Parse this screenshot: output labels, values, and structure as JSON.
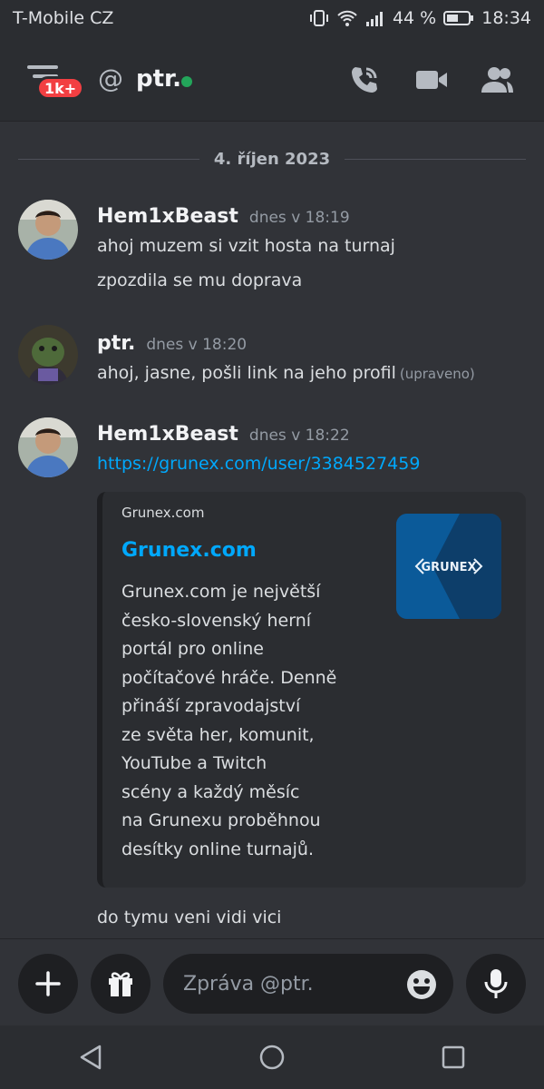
{
  "status_bar": {
    "carrier": "T-Mobile CZ",
    "battery_percent": "44 %",
    "time": "18:34"
  },
  "header": {
    "unread_badge": "1k+",
    "at_symbol": "@",
    "channel_name": "ptr.",
    "status": "online",
    "icons": [
      "menu-icon",
      "call-icon",
      "video-icon",
      "members-icon"
    ]
  },
  "date_divider": "4. říjen 2023",
  "messages": [
    {
      "author": "Hem1xBeast",
      "time": "dnes v 18:19",
      "lines": [
        "ahoj muzem si vzit hosta na turnaj",
        "zpozdila se mu doprava"
      ]
    },
    {
      "author": "ptr.",
      "time": "dnes v 18:20",
      "text": "ahoj, jasne, pošli link na jeho profil",
      "edited": "(upraveno)"
    },
    {
      "author": "Hem1xBeast",
      "time": "dnes v 18:22",
      "link": "https://grunex.com/user/3384527459",
      "after_embed": "do tymu veni vidi vici"
    }
  ],
  "embed": {
    "provider": "Grunex.com",
    "title": "Grunex.com",
    "description_lines": [
      "Grunex.com je největší",
      "česko-slovenský herní",
      "portál pro online",
      "počítačové hráče. Denně",
      "přináší zpravodajství",
      "ze světa her, komunit,",
      "YouTube a Twitch",
      "scény a každý měsíc",
      "na Grunexu proběhnou",
      "desítky online turnajů."
    ],
    "thumbnail_text": "GRUNEX"
  },
  "composer": {
    "placeholder": "Zpráva @ptr."
  },
  "colors": {
    "background": "#313338",
    "link": "#00a8fc",
    "online": "#23a55a",
    "badge": "#f23f42"
  }
}
